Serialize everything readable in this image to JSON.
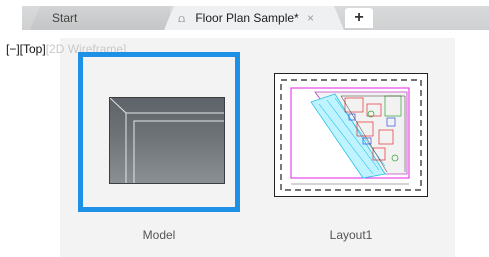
{
  "tabs": {
    "start_label": "Start",
    "active_label": "Floor Plan Sample*",
    "lock_icon": "lock-icon",
    "close_glyph": "×",
    "new_tab_glyph": "+"
  },
  "viewport": {
    "controls_prefix": "[−][Top]",
    "controls_dim": "[2D Wireframe]"
  },
  "thumbnails": {
    "model_label": "Model",
    "layout_label": "Layout1",
    "selected": "Model"
  },
  "colors": {
    "selection_border": "#1e90e6",
    "layout_border_magenta": "#e020e0",
    "layout_cyan": "#27c3e8"
  }
}
